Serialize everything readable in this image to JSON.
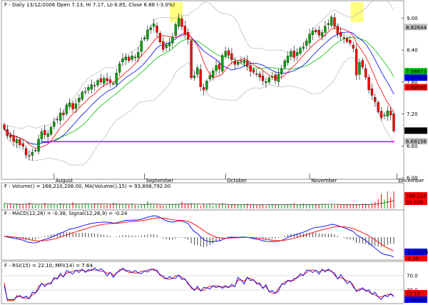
{
  "header": {
    "main": "F - Daily 13/12/2006 Open 7.13, Hi 7.17, Lo 6.85, Close 6.88 (-3.0%)",
    "volume": "F - Volume() = 168,210,208.00, MA(Volume(),15) = 93,898,792.00",
    "macd": "F - MACD(12,26) = -0.38, Signal(12,26,9) = -0.24",
    "rsi": "F - RSI(15) = 22.10, MFI(14) = 7.64"
  },
  "months": [
    "August",
    "September",
    "October",
    "November",
    "December"
  ],
  "price_ticks": [
    "9.00",
    "8.40",
    "7.80",
    "7.20",
    "6.60",
    "6.00"
  ],
  "price_tags": [
    {
      "text": "8.82644",
      "color": "#c0c0c0",
      "text_color": "#000000"
    },
    {
      "text": "7.98873",
      "color": "#00c000",
      "text_color": "#ffffff"
    },
    {
      "text": "7.87534",
      "color": "#0000ff",
      "text_color": "#ffffff"
    },
    {
      "text": "7.69595",
      "color": "#ff0000",
      "text_color": "#ffffff"
    },
    {
      "text": "6.88",
      "color": "#000000",
      "text_color": "#ffffff"
    },
    {
      "text": "6.68156",
      "color": "#c0c0c0",
      "text_color": "#000000"
    }
  ],
  "volume_tags": [
    {
      "text": "168,210",
      "color": "#ff0000",
      "text_color": "#000000"
    },
    {
      "text": "93,898",
      "color": "#ff0000",
      "text_color": "#000000"
    }
  ],
  "macd_tags": [
    {
      "text": "-0.23936",
      "color": "#0000ff",
      "text_color": "#ffffff"
    },
    {
      "text": "-0.38",
      "color": "#ff0000",
      "text_color": "#ffffff"
    }
  ],
  "rsi_ticks": [
    "70.0",
    "30.0"
  ],
  "rsi_tags": [
    {
      "text": "22.10",
      "color": "#ff0000",
      "text_color": "#ffffff"
    },
    {
      "text": "7.64062",
      "color": "#0000ff",
      "text_color": "#ffffff"
    }
  ],
  "colors": {
    "up": "#00a000",
    "down": "#ff0000",
    "ma_short": "#ff0000",
    "ma_long": "#00c000",
    "bollinger": "#c0c0c0",
    "support": "#ff00ff",
    "highlight": "#ffff80",
    "macd_line": "#0000ff",
    "signal_line": "#ff0000",
    "rsi_line": "#ff0000",
    "mfi_line": "#0000ff"
  },
  "chart_data": [
    {
      "type": "candlestick",
      "title": "F - Daily 13/12/2006 Open 7.13, Hi 7.17, Lo 6.85, Close 6.88 (-3.0%)",
      "ylim": [
        6.0,
        9.3
      ],
      "support_line": 6.68,
      "highlights": [
        55,
        113
      ],
      "x_months": [
        {
          "label": "August",
          "index": 16
        },
        {
          "label": "September",
          "index": 45
        },
        {
          "label": "October",
          "index": 71
        },
        {
          "label": "November",
          "index": 98
        },
        {
          "label": "December",
          "index": 126
        }
      ],
      "last_values": {
        "upper_band": 8.82644,
        "ma_long": 7.98873,
        "ma_mid": 7.87534,
        "ma_short": 7.69595,
        "close": 6.88,
        "lower_band": 6.68156
      },
      "closes": [
        6.92,
        6.79,
        6.76,
        6.68,
        6.72,
        6.62,
        6.59,
        6.43,
        6.41,
        6.48,
        6.52,
        6.73,
        6.87,
        6.81,
        6.83,
        6.95,
        7.05,
        7.1,
        7.22,
        7.18,
        7.37,
        7.41,
        7.29,
        7.39,
        7.5,
        7.61,
        7.62,
        7.7,
        7.75,
        7.73,
        7.83,
        7.8,
        7.87,
        7.82,
        7.8,
        7.77,
        7.97,
        8.14,
        8.24,
        8.27,
        8.2,
        8.29,
        8.27,
        8.36,
        8.57,
        8.63,
        8.78,
        8.82,
        8.89,
        8.73,
        8.55,
        8.41,
        8.5,
        8.53,
        8.65,
        8.88,
        9.0,
        8.84,
        8.7,
        8.6,
        7.88,
        7.92,
        8.07,
        7.71,
        7.65,
        7.82,
        7.92,
        8.01,
        8.11,
        8.04,
        8.3,
        8.38,
        8.3,
        8.22,
        8.13,
        8.17,
        8.19,
        8.21,
        8.1,
        8.0,
        7.98,
        7.95,
        7.89,
        7.82,
        7.81,
        7.88,
        7.9,
        7.83,
        7.95,
        8.05,
        8.2,
        8.29,
        8.37,
        8.26,
        8.36,
        8.43,
        8.46,
        8.57,
        8.7,
        8.76,
        8.74,
        8.68,
        8.73,
        8.85,
        8.9,
        9.02,
        8.84,
        8.7,
        8.66,
        8.62,
        8.56,
        8.53,
        8.43,
        7.93,
        8.17,
        8.08,
        7.89,
        7.65,
        7.55,
        7.43,
        7.24,
        7.13,
        7.18,
        7.26,
        7.18,
        6.88
      ],
      "volumes": [
        52,
        36,
        49,
        35,
        44,
        42,
        42,
        44,
        58,
        40,
        36,
        38,
        36,
        57,
        37,
        44,
        38,
        37,
        54,
        43,
        45,
        36,
        62,
        44,
        40,
        38,
        47,
        42,
        38,
        52,
        43,
        44,
        35,
        38,
        39,
        55,
        41,
        45,
        39,
        42,
        36,
        48,
        37,
        32,
        38,
        41,
        72,
        43,
        38,
        44,
        39,
        34,
        32,
        40,
        41,
        42,
        47,
        68,
        47,
        48,
        52,
        45,
        38,
        29,
        45,
        36,
        40,
        30,
        36,
        39,
        51,
        36,
        34,
        42,
        38,
        38,
        37,
        35,
        48,
        40,
        39,
        38,
        34,
        37,
        29,
        38,
        40,
        35,
        37,
        31,
        41,
        40,
        46,
        55,
        40,
        42,
        48,
        36,
        39,
        42,
        40,
        38,
        43,
        37,
        39,
        44,
        36,
        41,
        38,
        40,
        42,
        36,
        39,
        41,
        38,
        44,
        46,
        40,
        52,
        65,
        92,
        144,
        88,
        168,
        110,
        168
      ]
    }
  ]
}
